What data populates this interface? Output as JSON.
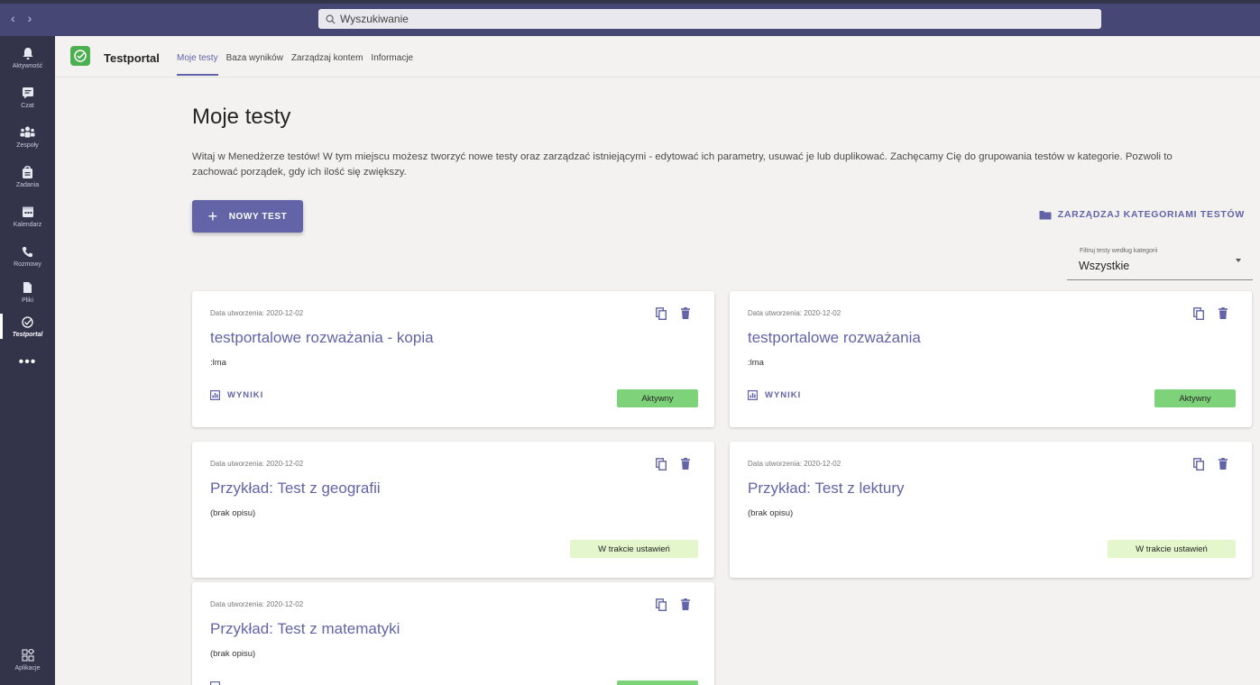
{
  "topbar": {
    "search_placeholder": "Wyszukiwanie"
  },
  "rail": {
    "items": [
      {
        "label": "Aktywność",
        "icon": "bell-icon"
      },
      {
        "label": "Czat",
        "icon": "chat-icon"
      },
      {
        "label": "Zespoły",
        "icon": "teams-icon"
      },
      {
        "label": "Zadania",
        "icon": "assignments-icon"
      },
      {
        "label": "Kalendarz",
        "icon": "calendar-icon"
      },
      {
        "label": "Rozmowy",
        "icon": "phone-icon"
      },
      {
        "label": "Pliki",
        "icon": "file-icon"
      },
      {
        "label": "Testportal",
        "icon": "testportal-icon"
      }
    ],
    "more_label": "•••",
    "apps_label": "Aplikacje"
  },
  "app": {
    "name": "Testportal",
    "tabs": [
      "Moje testy",
      "Baza wyników",
      "Zarządzaj kontem",
      "Informacje"
    ],
    "active_tab": "Moje testy"
  },
  "main": {
    "title": "Moje testy",
    "intro": "Witaj w Menedżerze testów! W tym miejscu możesz tworzyć nowe testy oraz zarządzać istniejącymi - edytować ich parametry, usuwać je lub duplikować. Zachęcamy Cię do grupowania testów w kategorie. Pozwoli to zachować porządek, gdy ich ilość się zwiększy.",
    "new_test_label": "NOWY TEST",
    "manage_categories_label": "ZARZĄDZAJ KATEGORIAMI TESTÓW",
    "filter_label": "Filtruj testy według kategorii",
    "filter_value": "Wszystkie"
  },
  "cards": [
    {
      "date": "Data utworzenia: 2020-12-02",
      "title": "testportalowe rozważania - kopia",
      "description": ":lma",
      "results_label": "WYNIKI",
      "status": "Aktywny",
      "status_type": "active"
    },
    {
      "date": "Data utworzenia: 2020-12-02",
      "title": "testportalowe rozważania",
      "description": ":lma",
      "results_label": "WYNIKI",
      "status": "Aktywny",
      "status_type": "active"
    },
    {
      "date": "Data utworzenia: 2020-12-02",
      "title": "Przykład: Test z geografii",
      "description": "(brak opisu)",
      "results_label": "",
      "status": "W trakcie ustawień",
      "status_type": "setup"
    },
    {
      "date": "Data utworzenia: 2020-12-02",
      "title": "Przykład: Test z lektury",
      "description": "(brak opisu)",
      "results_label": "",
      "status": "W trakcie ustawień",
      "status_type": "setup"
    },
    {
      "date": "Data utworzenia: 2020-12-02",
      "title": "Przykład: Test z matematyki",
      "description": "(brak opisu)",
      "results_label": "",
      "status": "",
      "status_type": ""
    }
  ],
  "colors": {
    "accent": "#6264a7",
    "topbar": "#464775",
    "rail": "#33344a",
    "active_badge": "#7ed37a",
    "setup_badge": "#e3f6cc"
  }
}
